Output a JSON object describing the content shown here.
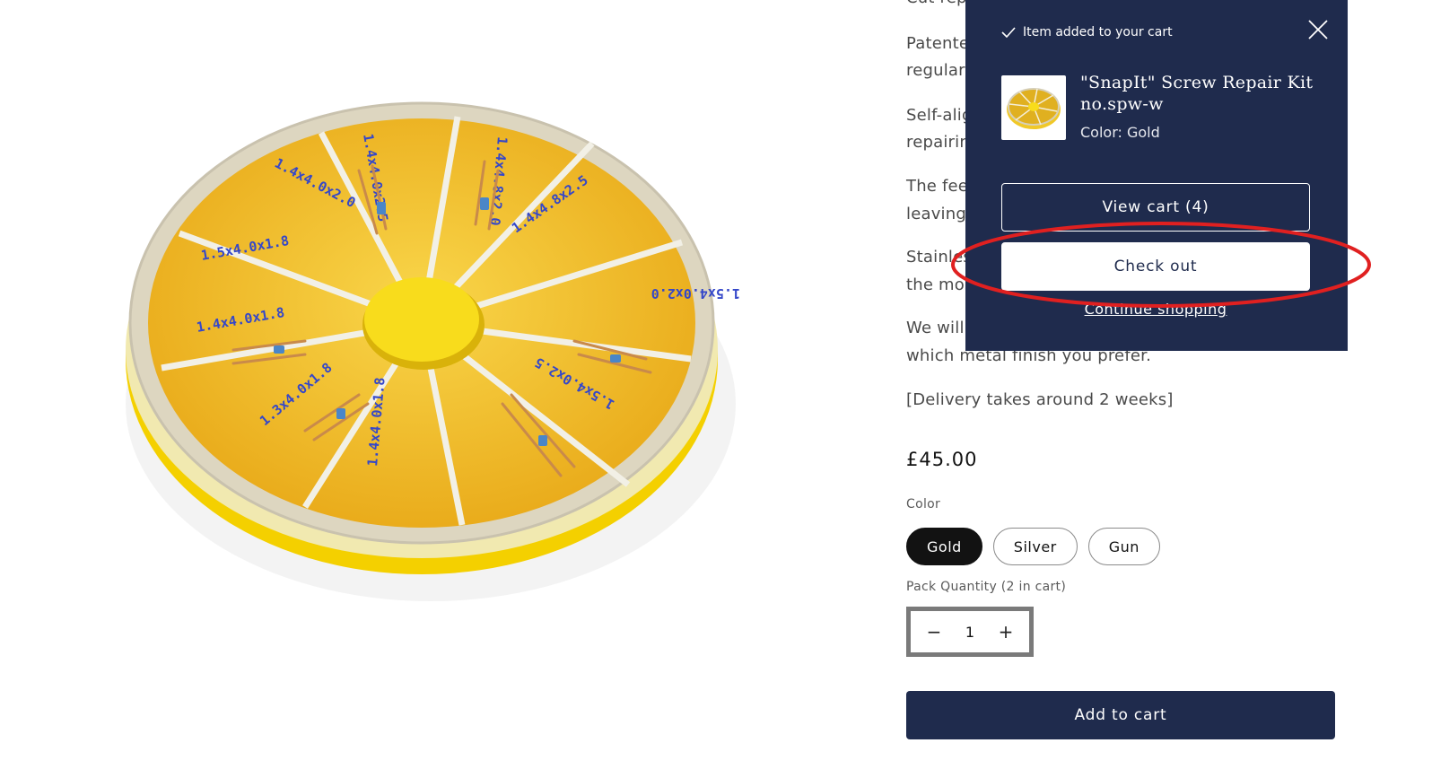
{
  "product": {
    "description_lines": [
      "Cut rep",
      "Patente",
      "regular",
      "Self-alig",
      "repairin",
      "The fee",
      "leaving",
      "Stainles",
      "the mos",
      "We will",
      "which metal finish you prefer.",
      "[Delivery takes around 2 weeks]"
    ],
    "price": "£45.00",
    "color_label": "Color",
    "colors": [
      "Gold",
      "Silver",
      "Gun"
    ],
    "selected_color": "Gold",
    "qty_label": "Pack Quantity (2 in cart)",
    "qty_minus": "−",
    "qty_value": "1",
    "qty_plus": "+",
    "add_to_cart": "Add to cart",
    "image_labels": [
      "1.4x4.0x2.0",
      "1.4x4.0x2.5",
      "1.4x4.8x2.0",
      "1.4x4.8x2.5",
      "1.5x4.0x2.0",
      "1.5x4.0x2.5",
      "1.4x4.0x1.8",
      "1.3x4.0x1.8",
      "1.4x4.0x1.8",
      "1.5x4.0x1.8"
    ]
  },
  "cart_notification": {
    "added_text": "Item added to your cart",
    "item_title": "\"SnapIt\" Screw Repair Kit no.spw-w",
    "item_color": "Color: Gold",
    "view_cart": "View cart (4)",
    "check_out": "Check out",
    "continue_shopping": "Continue shopping"
  },
  "colors": {
    "navy": "#1f2b4d",
    "highlight": "#e02020",
    "tray_yellow": "#f6c21c"
  }
}
